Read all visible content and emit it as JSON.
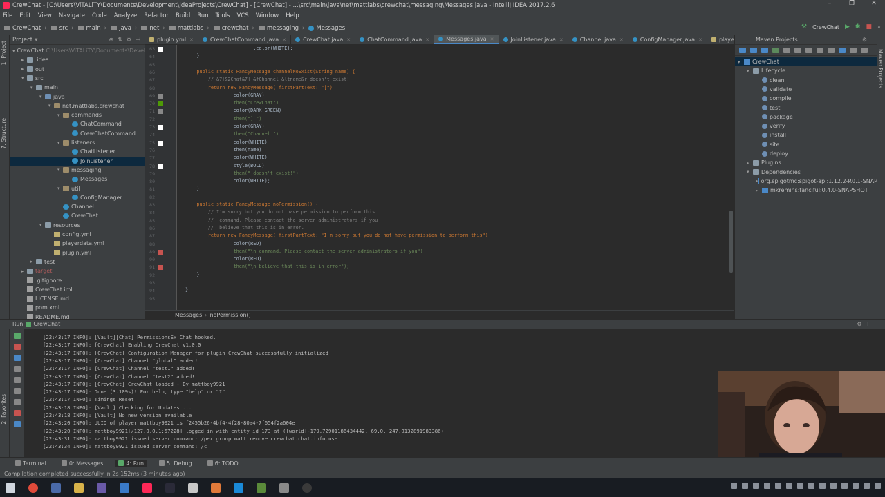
{
  "window": {
    "title": "CrewChat - [C:\\Users\\ViTALiTY\\Documents\\Development\\ideaProjects\\CrewChat] - [CrewChat] - ...\\src\\main\\java\\net\\mattlabs\\crewchat\\messaging\\Messages.java - IntelliJ IDEA 2017.2.6"
  },
  "menu": [
    "File",
    "Edit",
    "View",
    "Navigate",
    "Code",
    "Analyze",
    "Refactor",
    "Build",
    "Run",
    "Tools",
    "VCS",
    "Window",
    "Help"
  ],
  "breadcrumb": [
    "CrewChat",
    "src",
    "main",
    "java",
    "net",
    "mattlabs",
    "crewchat",
    "messaging",
    "Messages"
  ],
  "run_config": "CrewChat",
  "project": {
    "header": "Project",
    "nodes": [
      {
        "label": "CrewChat",
        "extra": "C:\\Users\\ViTALiTY\\Documents\\Devel",
        "icon": "folder",
        "arrow": "▾",
        "depth": 0
      },
      {
        "label": ".idea",
        "icon": "folder",
        "arrow": "▸",
        "depth": 1
      },
      {
        "label": "out",
        "icon": "folder",
        "arrow": "▸",
        "depth": 1
      },
      {
        "label": "src",
        "icon": "folder",
        "arrow": "▾",
        "depth": 1
      },
      {
        "label": "main",
        "icon": "folder",
        "arrow": "▾",
        "depth": 2
      },
      {
        "label": "java",
        "icon": "src",
        "arrow": "▾",
        "depth": 3
      },
      {
        "label": "net.mattlabs.crewchat",
        "icon": "pkg",
        "arrow": "▾",
        "depth": 4
      },
      {
        "label": "commands",
        "icon": "pkg",
        "arrow": "▾",
        "depth": 5
      },
      {
        "label": "ChatCommand",
        "icon": "cls",
        "arrow": "",
        "depth": 6
      },
      {
        "label": "CrewChatCommand",
        "icon": "cls",
        "arrow": "",
        "depth": 6
      },
      {
        "label": "listeners",
        "icon": "pkg",
        "arrow": "▾",
        "depth": 5
      },
      {
        "label": "ChatListener",
        "icon": "cls",
        "arrow": "",
        "depth": 6
      },
      {
        "label": "JoinListener",
        "icon": "cls",
        "arrow": "",
        "depth": 6,
        "selected": true
      },
      {
        "label": "messaging",
        "icon": "pkg",
        "arrow": "▾",
        "depth": 5
      },
      {
        "label": "Messages",
        "icon": "cls",
        "arrow": "",
        "depth": 6
      },
      {
        "label": "util",
        "icon": "pkg",
        "arrow": "▾",
        "depth": 5
      },
      {
        "label": "ConfigManager",
        "icon": "cls",
        "arrow": "",
        "depth": 6
      },
      {
        "label": "Channel",
        "icon": "cls",
        "arrow": "",
        "depth": 5
      },
      {
        "label": "CrewChat",
        "icon": "cls",
        "arrow": "",
        "depth": 5
      },
      {
        "label": "resources",
        "icon": "folder",
        "arrow": "▾",
        "depth": 3
      },
      {
        "label": "config.yml",
        "icon": "yml",
        "arrow": "",
        "depth": 4
      },
      {
        "label": "playerdata.yml",
        "icon": "yml",
        "arrow": "",
        "depth": 4
      },
      {
        "label": "plugin.yml",
        "icon": "yml",
        "arrow": "",
        "depth": 4
      },
      {
        "label": "test",
        "icon": "folder",
        "arrow": "▸",
        "depth": 2
      },
      {
        "label": "target",
        "icon": "folder",
        "arrow": "▸",
        "depth": 1,
        "red": true
      },
      {
        "label": ".gitignore",
        "icon": "file",
        "arrow": "",
        "depth": 1
      },
      {
        "label": "CrewChat.iml",
        "icon": "file",
        "arrow": "",
        "depth": 1
      },
      {
        "label": "LICENSE.md",
        "icon": "file",
        "arrow": "",
        "depth": 1
      },
      {
        "label": "pom.xml",
        "icon": "file",
        "arrow": "",
        "depth": 1
      },
      {
        "label": "README.md",
        "icon": "file",
        "arrow": "",
        "depth": 1
      }
    ]
  },
  "tabs": [
    {
      "label": "plugin.yml",
      "kind": "yml"
    },
    {
      "label": "CrewChatCommand.java",
      "kind": "cls"
    },
    {
      "label": "CrewChat.java",
      "kind": "cls"
    },
    {
      "label": "ChatCommand.java",
      "kind": "cls"
    },
    {
      "label": "Messages.java",
      "kind": "cls",
      "active": true
    },
    {
      "label": "JoinListener.java",
      "kind": "cls"
    },
    {
      "label": "Channel.java",
      "kind": "cls"
    },
    {
      "label": "ConfigManager.java",
      "kind": "cls"
    },
    {
      "label": "playerdata.yml",
      "kind": "yml"
    }
  ],
  "editor": {
    "line_numbers": [
      "63",
      "64",
      "65",
      "66",
      "67",
      "68",
      "69",
      "70",
      "71",
      "72",
      "73",
      "74",
      "75",
      "76",
      "77",
      "78",
      "79",
      "80",
      "81",
      "82",
      "83",
      "84",
      "85",
      "86",
      "87",
      "88",
      "89",
      "90",
      "91",
      "92",
      "93",
      "94",
      "95"
    ],
    "lines": [
      "                        .color(WHITE);",
      "    }",
      "",
      "    public static FancyMessage channelNoExist(String name) {",
      "        // &7[&2Chat&7] &fChannel &ltname&r doesn't exist!",
      "        return new FancyMessage( firstPartText: \"[\")",
      "                .color(GRAY)",
      "                .then(\"CrewChat\")",
      "                .color(DARK_GREEN)",
      "                .then(\"] \")",
      "                .color(GRAY)",
      "                .then(\"Channel \")",
      "                .color(WHITE)",
      "                .then(name)",
      "                .color(WHITE)",
      "                .style(BOLD)",
      "                .then(\" doesn't exist!\")",
      "                .color(WHITE);",
      "    }",
      "",
      "    public static FancyMessage noPermission() {",
      "        // I'm sorry but you do not have permission to perform this",
      "        //  command. Please contact the server administrators if you",
      "        //  believe that this is in error.",
      "        return new FancyMessage( firstPartText: \"I'm sorry but you do not have permission to perform this\")",
      "                .color(RED)",
      "                .then(\"\\n command. Please contact the server administrators if you\")",
      "                .color(RED)",
      "                .then(\"\\n believe that this is in error\");",
      "    }",
      "",
      "}",
      ""
    ],
    "breadcrumb": [
      "Messages",
      "noPermission()"
    ]
  },
  "maven": {
    "header": "Maven Projects",
    "nodes": [
      {
        "label": "CrewChat",
        "icon": "m",
        "arrow": "▾",
        "depth": 0,
        "selected": true
      },
      {
        "label": "Lifecycle",
        "icon": "folder",
        "arrow": "▾",
        "depth": 1
      },
      {
        "label": "clean",
        "icon": "gear",
        "arrow": "",
        "depth": 2
      },
      {
        "label": "validate",
        "icon": "gear",
        "arrow": "",
        "depth": 2
      },
      {
        "label": "compile",
        "icon": "gear",
        "arrow": "",
        "depth": 2
      },
      {
        "label": "test",
        "icon": "gear",
        "arrow": "",
        "depth": 2
      },
      {
        "label": "package",
        "icon": "gear",
        "arrow": "",
        "depth": 2
      },
      {
        "label": "verify",
        "icon": "gear",
        "arrow": "",
        "depth": 2
      },
      {
        "label": "install",
        "icon": "gear",
        "arrow": "",
        "depth": 2
      },
      {
        "label": "site",
        "icon": "gear",
        "arrow": "",
        "depth": 2
      },
      {
        "label": "deploy",
        "icon": "gear",
        "arrow": "",
        "depth": 2
      },
      {
        "label": "Plugins",
        "icon": "folder",
        "arrow": "▸",
        "depth": 1
      },
      {
        "label": "Dependencies",
        "icon": "folder",
        "arrow": "▾",
        "depth": 1
      },
      {
        "label": "org.spigotmc:spigot-api:1.12.2-R0.1-SNAP",
        "icon": "m",
        "arrow": "▸",
        "depth": 2
      },
      {
        "label": "mkremins:fanciful:0.4.0-SNAPSHOT",
        "icon": "m",
        "arrow": "▸",
        "depth": 2
      }
    ]
  },
  "run": {
    "header": "Run",
    "config": "CrewChat",
    "console": [
      "[22:43:17 INFO]: [Vault][Chat] PermissionsEx_Chat hooked.",
      "[22:43:17 INFO]: [CrewChat] Enabling CrewChat v1.0.0",
      "[22:43:17 INFO]: [CrewChat] Configuration Manager for plugin CrewChat successfully initialized",
      "[22:43:17 INFO]: [CrewChat] Channel \"global\" added!",
      "[22:43:17 INFO]: [CrewChat] Channel \"test1\" added!",
      "[22:43:17 INFO]: [CrewChat] Channel \"test2\" added!",
      "[22:43:17 INFO]: [CrewChat] CrewChat loaded - By mattboy9921",
      "[22:43:17 INFO]: Done (3.109s)! For help, type \"help\" or \"?\"",
      "[22:43:17 INFO]: Timings Reset",
      "[22:43:18 INFO]: [Vault] Checking for Updates ...",
      "[22:43:18 INFO]: [Vault] No new version available",
      "[22:43:20 INFO]: UUID of player mattboy9921 is f2455b26-4bf4-4f28-80a4-7f654f2a604e",
      "[22:43:20 INFO]: mattboy9921[/127.0.0.1:57228] logged in with entity id 173 at ([world]-179.72901186434442, 69.0, 247.0132891983386)",
      "[22:43:31 INFO]: mattboy9921 issued server command: /pex group matt remove crewchat.chat.info.use",
      "[22:43:34 INFO]: mattboy9921 issued server command: /c"
    ]
  },
  "toolwindows": [
    {
      "label": "Terminal"
    },
    {
      "label": "0: Messages"
    },
    {
      "label": "4: Run",
      "active": true
    },
    {
      "label": "5: Debug"
    },
    {
      "label": "6: TODO"
    }
  ],
  "status": "Compilation completed successfully in 2s 152ms (3 minutes ago)",
  "colors": {
    "accent": "#4a88c7",
    "keyword": "#cc7832",
    "string": "#6a8759",
    "comment": "#808080",
    "selection": "#0d293e"
  }
}
